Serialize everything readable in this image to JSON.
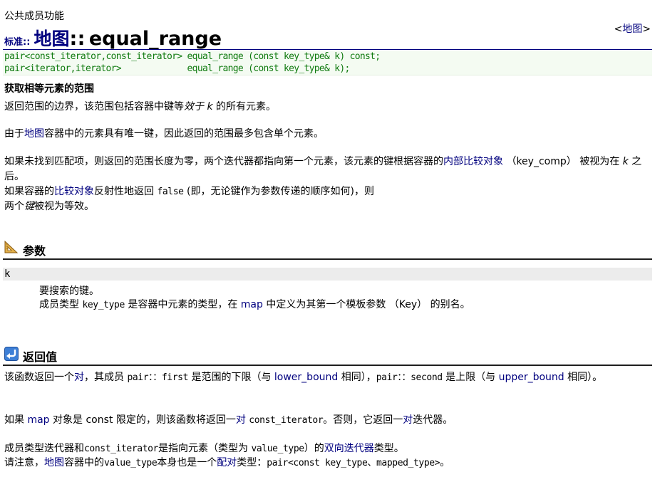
{
  "header": {
    "kind": "公共成员功能",
    "title_prefix": "标准::",
    "title_container": "地图",
    "title_sep": "::",
    "title_function": "equal_range",
    "link_left": "<",
    "link_text": "地图",
    "link_right": ">"
  },
  "prototypes": [
    "pair<const_iterator,const_iterator> equal_range (const key_type& k) const;",
    "pair<iterator,iterator>             equal_range (const key_type& k);"
  ],
  "summary": "获取相等元素的范围",
  "description": {
    "p1_a": "返回范围的边界，该范围包括容器中键等",
    "p1_equiv": "效于",
    "p1_k": "k",
    "p1_b": "的所有元素。",
    "p2_a": "由于",
    "p2_link": "地图",
    "p2_b": "容器中的元素具有唯一键，因此返回的范围最多包含单个元素。",
    "p3_a": "如果未找到匹配项，则返回的范围长度为零，两个迭代器都指向第一个元素，该元素的键根据容器的",
    "p3_link": "内部比较对象",
    "p3_b": "（key_comp） 被视为在",
    "p3_k": "k",
    "p3_c": "之后。",
    "p4_a": "如果容器的",
    "p4_link": "比较对象",
    "p4_b": "反射性地返回",
    "p4_code": "false",
    "p4_c": "(即，无论键作为参数传递的顺序如何)，则",
    "p4_d": "两个",
    "p4_keys": "键",
    "p4_e": "被视为等效。"
  },
  "parameters": {
    "heading": "参数",
    "name": "k",
    "desc1": "要搜索的键。",
    "desc2_a": "成员类型",
    "desc2_code": "key_type",
    "desc2_b": "是容器中元素的类型，在",
    "desc2_link": "map",
    "desc2_c": "中定义为其第一个模板参数 （Key） 的别名。"
  },
  "return_value": {
    "heading": "返回值",
    "r1_a": "该函数返回一个",
    "r1_link": "对",
    "r1_b": "，其成员",
    "r1_code1": "pair：：first",
    "r1_c": "是范围的下限（与",
    "r1_link2": "lower_bound",
    "r1_d": "相同），",
    "r1_code2": "pair：：second",
    "r1_e": "是上限（与",
    "r1_link3": "upper_bound",
    "r1_f": "相同）。",
    "r2_a": "如果",
    "r2_link": "map",
    "r2_b": "对象是 const 限定的，则该函数将返回一",
    "r2_link2": "对",
    "r2_code": "const_iterator",
    "r2_c": "。否则，它返回一",
    "r2_link3": "对",
    "r2_d": "迭代器。",
    "r3_a": "成员类型迭代器和",
    "r3_code1": "const_iterator",
    "r3_b": "是指向元素（类型为",
    "r3_code2": "value_type",
    "r3_c": "）的",
    "r3_link": "双向迭代器",
    "r3_d": "类型。",
    "r4_a": "请注意，",
    "r4_link": "地图",
    "r4_b": "容器中的",
    "r4_code1": "value_type",
    "r4_c": "本身也是一个",
    "r4_link2": "配对",
    "r4_d": "类型：",
    "r4_code2": "pair<const key_type、mapped_type>",
    "r4_e": "。"
  },
  "colors": {
    "link": "#00007f",
    "prototype_text": "#0f7a0f",
    "prototype_bg": "#f4fbf2",
    "section_rule": "#1e1e1e"
  },
  "icons": {
    "parameters": "set-square-icon",
    "return_value": "return-arrow-icon"
  }
}
